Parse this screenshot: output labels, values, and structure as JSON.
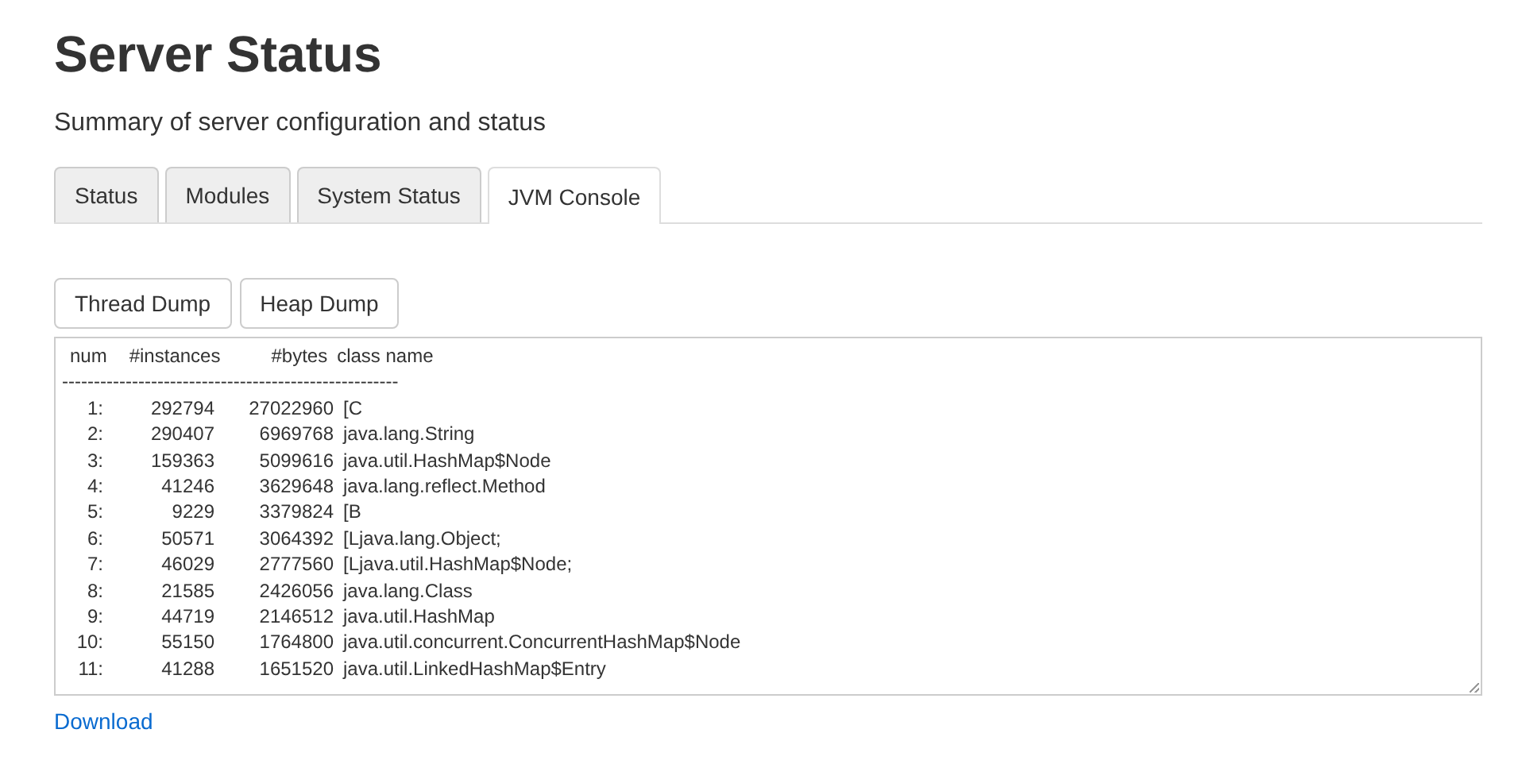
{
  "title": "Server Status",
  "subtitle": "Summary of server configuration and status",
  "tabs": [
    {
      "label": "Status",
      "selected": false
    },
    {
      "label": "Modules",
      "selected": false
    },
    {
      "label": "System Status",
      "selected": false
    },
    {
      "label": "JVM Console",
      "selected": true
    }
  ],
  "buttons": [
    "Thread Dump",
    "Heap Dump"
  ],
  "console": {
    "columns": [
      "num",
      "#instances",
      "#bytes",
      "class name"
    ],
    "divider": "-----------------------------------------------------",
    "rows": [
      [
        "1:",
        "292794",
        "27022960",
        "[C"
      ],
      [
        "2:",
        "290407",
        "6969768",
        "java.lang.String"
      ],
      [
        "3:",
        "159363",
        "5099616",
        "java.util.HashMap$Node"
      ],
      [
        "4:",
        "41246",
        "3629648",
        "java.lang.reflect.Method"
      ],
      [
        "5:",
        "9229",
        "3379824",
        "[B"
      ],
      [
        "6:",
        "50571",
        "3064392",
        "[Ljava.lang.Object;"
      ],
      [
        "7:",
        "46029",
        "2777560",
        "[Ljava.util.HashMap$Node;"
      ],
      [
        "8:",
        "21585",
        "2426056",
        "java.lang.Class"
      ],
      [
        "9:",
        "44719",
        "2146512",
        "java.util.HashMap"
      ],
      [
        "10:",
        "55150",
        "1764800",
        "java.util.concurrent.ConcurrentHashMap$Node"
      ],
      [
        "11:",
        "41288",
        "1651520",
        "java.util.LinkedHashMap$Entry"
      ]
    ]
  },
  "download_link": "Download"
}
